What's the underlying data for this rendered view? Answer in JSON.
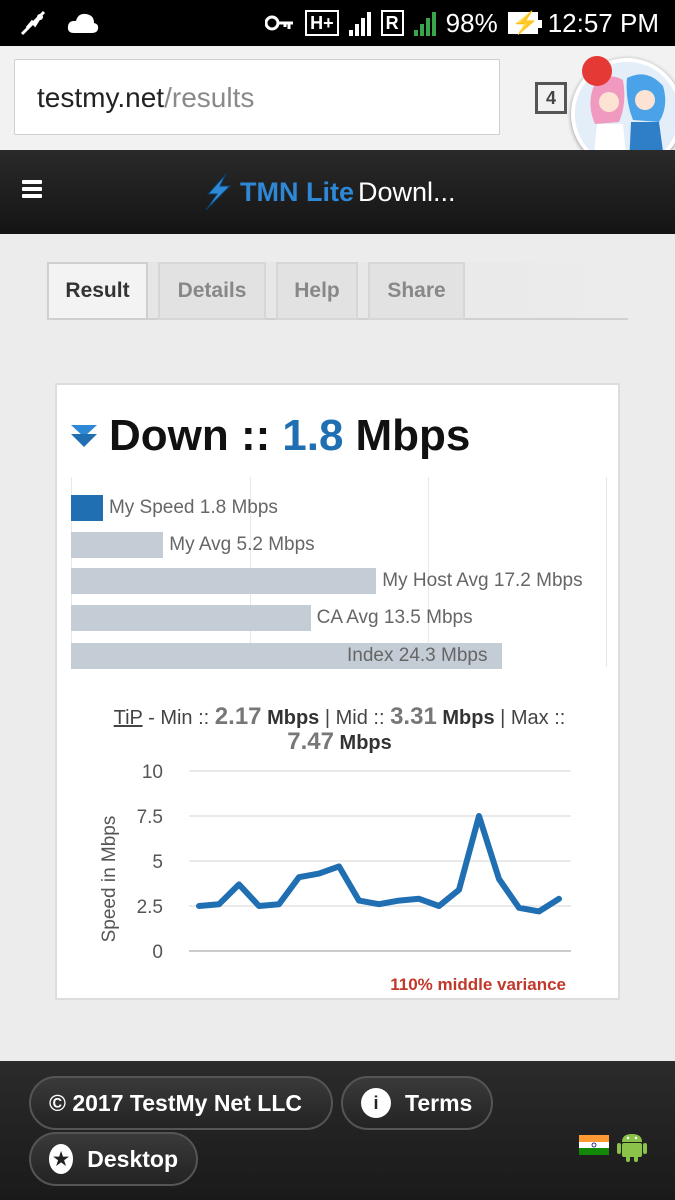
{
  "status_bar": {
    "network_badge": "H+",
    "sim1": "1",
    "roaming_badge": "R",
    "sim2": "2",
    "battery": "98%",
    "time": "12:57 PM"
  },
  "browser": {
    "url_host": "testmy.net",
    "url_path": "/results",
    "tab_count": "4"
  },
  "site_header": {
    "brand": "TMN Lite",
    "title": "Downl..."
  },
  "tabs": [
    {
      "label": "Result",
      "active": true
    },
    {
      "label": "Details",
      "active": false
    },
    {
      "label": "Help",
      "active": false
    },
    {
      "label": "Share",
      "active": false
    }
  ],
  "result": {
    "direction": "Down ::",
    "speed": "1.8",
    "unit": "Mbps",
    "comparison": [
      {
        "label": "My Speed 1.8 Mbps",
        "value": 1.8,
        "color": "#1f6fb2"
      },
      {
        "label": "My Avg 5.2 Mbps",
        "value": 5.2,
        "color": "#c4cdd6"
      },
      {
        "label": "My Host Avg 17.2 Mbps",
        "value": 17.2,
        "color": "#c4cdd6"
      },
      {
        "label": "CA Avg 13.5 Mbps",
        "value": 13.5,
        "color": "#c4cdd6"
      },
      {
        "label": "Index 24.3 Mbps",
        "value": 24.3,
        "color": "#c4cdd6"
      }
    ],
    "tip": {
      "link": "TiP",
      "min_label": "- Min ::",
      "min_value": "2.17",
      "mid_label": "| Mid ::",
      "mid_value": "3.31",
      "max_label": "| Max ::",
      "max_value": "7.47",
      "unit": "Mbps"
    },
    "variance": "110% middle variance"
  },
  "chart_data": {
    "type": "line",
    "title": "",
    "xlabel": "",
    "ylabel": "Speed in Mbps",
    "ylim": [
      0,
      10
    ],
    "yticks": [
      "10",
      "7.5",
      "5",
      "2.5",
      "0"
    ],
    "grid": true,
    "color": "#1f6fb2",
    "series": [
      {
        "values": [
          2.5,
          2.6,
          3.7,
          2.5,
          2.6,
          4.1,
          4.3,
          4.7,
          2.8,
          2.6,
          2.8,
          2.9,
          2.5,
          3.4,
          7.5,
          4.0,
          2.4,
          2.2,
          2.9
        ]
      }
    ]
  },
  "footer": {
    "copyright": "© 2017 TestMy Net LLC",
    "terms": "Terms",
    "desktop": "Desktop"
  }
}
